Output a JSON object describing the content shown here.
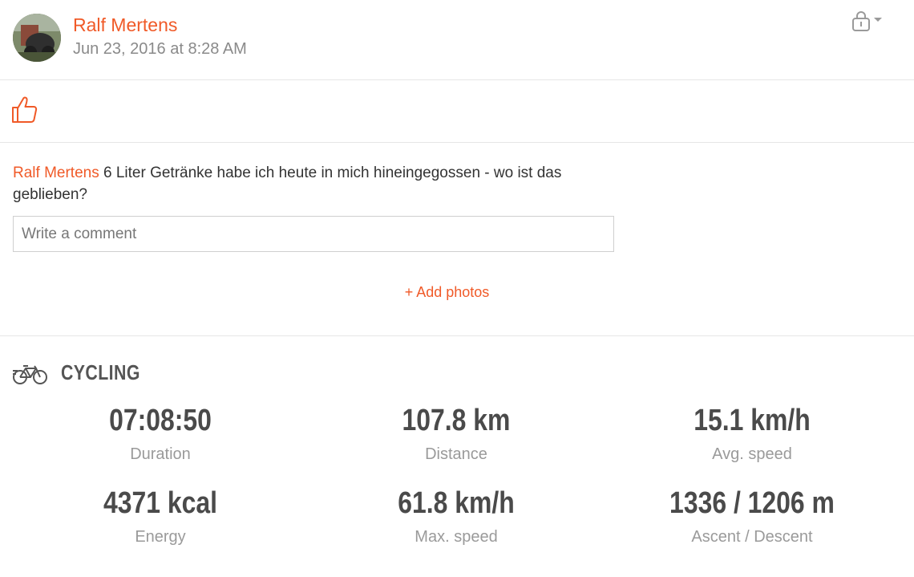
{
  "post": {
    "user_name": "Ralf Mertens",
    "date": "Jun 23, 2016 at 8:28 AM",
    "avatar_icon": "profile-photo-avatar",
    "privacy_icon": "lock-icon"
  },
  "like": {
    "icon": "thumbs-up-icon"
  },
  "comments": {
    "items": [
      {
        "author": "Ralf Mertens",
        "text": "6 Liter Getränke habe ich heute in mich hineingegossen - wo ist das geblieben?"
      }
    ],
    "input_placeholder": "Write a comment",
    "add_photos_label": "+ Add photos"
  },
  "workout": {
    "sport_icon": "bicycle-icon",
    "sport": "CYCLING",
    "stats": [
      {
        "value": "07:08:50",
        "label": "Duration"
      },
      {
        "value": "107.8 km",
        "label": "Distance"
      },
      {
        "value": "15.1 km/h",
        "label": "Avg. speed"
      },
      {
        "value": "4371 kcal",
        "label": "Energy"
      },
      {
        "value": "61.8 km/h",
        "label": "Max. speed"
      },
      {
        "value": "1336 / 1206 m",
        "label": "Ascent / Descent"
      }
    ]
  },
  "colors": {
    "accent": "#f05a28",
    "text": "#333333",
    "muted": "#8a8a8a",
    "divider": "#e6e6e6"
  }
}
